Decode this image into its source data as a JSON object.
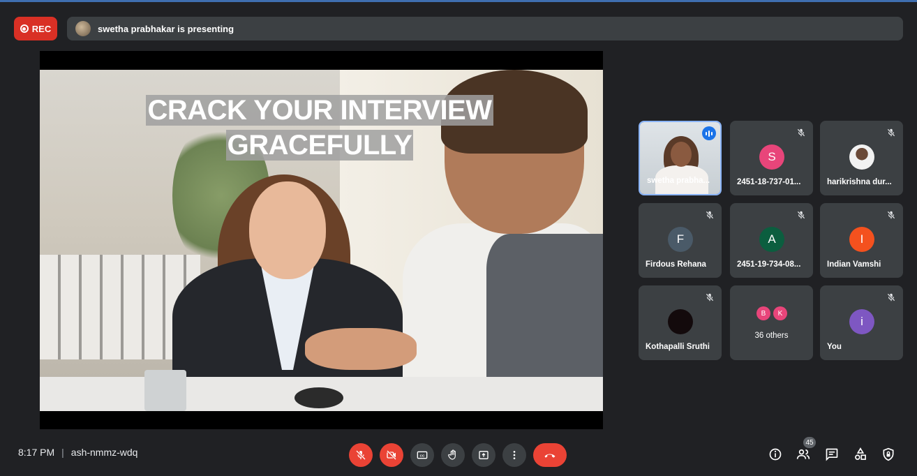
{
  "header": {
    "rec_label": "REC",
    "presenting_text": "swetha prabhakar is presenting"
  },
  "slide": {
    "title_line1": "CRACK YOUR INTERVIEW",
    "title_line2": "GRACEFULLY"
  },
  "participants": [
    {
      "name": "swetha prabha...",
      "type": "video",
      "speaking": true
    },
    {
      "name": "2451-18-737-01...",
      "initial": "S",
      "color": "#e8457a",
      "muted": true
    },
    {
      "name": "harikrishna dur...",
      "type": "photo",
      "muted": true
    },
    {
      "name": "Firdous Rehana",
      "initial": "F",
      "color": "#4a5a68",
      "muted": true
    },
    {
      "name": "2451-19-734-08...",
      "initial": "A",
      "color": "#0b5e3f",
      "muted": true
    },
    {
      "name": "Indian Vamshi",
      "initial": "I",
      "color": "#f4511e",
      "muted": true
    },
    {
      "name": "Kothapalli Sruthi",
      "type": "photo-dark",
      "muted": true
    },
    {
      "name": "36 others",
      "type": "others",
      "avatars": [
        "B",
        "K"
      ]
    },
    {
      "name": "You",
      "initial": "i",
      "color": "#7e57c2",
      "muted": true
    }
  ],
  "footer": {
    "time": "8:17 PM",
    "separator": "|",
    "meeting_code": "ash-nmmz-wdq",
    "participant_count": "45"
  },
  "colors": {
    "background": "#202124",
    "danger": "#ea4335",
    "accent": "#1a73e8"
  }
}
